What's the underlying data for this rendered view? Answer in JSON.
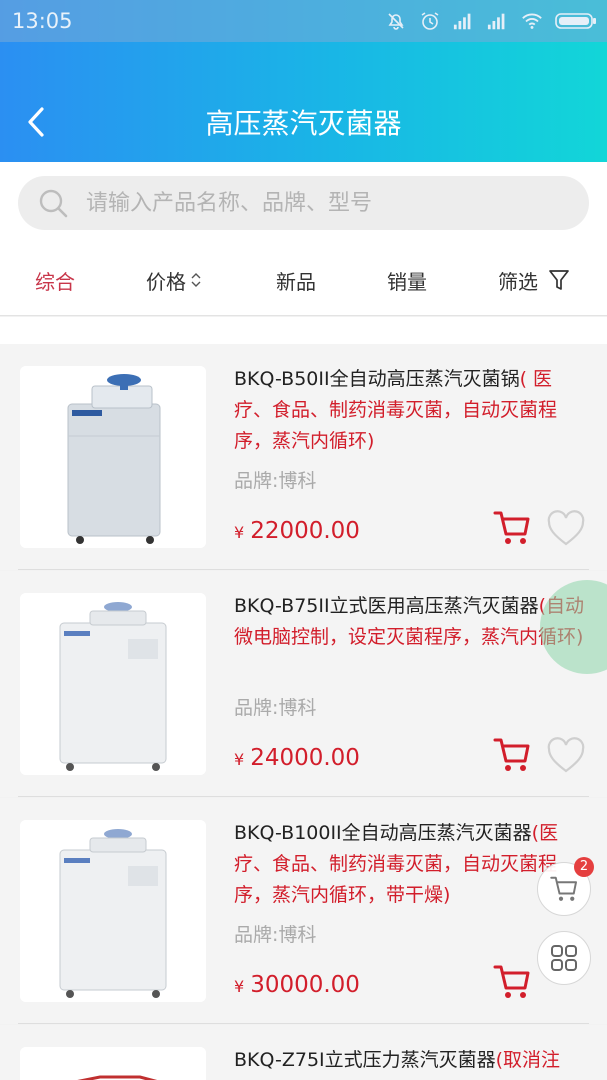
{
  "status": {
    "time": "13:05"
  },
  "header": {
    "title": "高压蒸汽灭菌器"
  },
  "search": {
    "placeholder": "请输入产品名称、品牌、型号"
  },
  "sort": {
    "items": [
      {
        "label": "综合",
        "active": true
      },
      {
        "label": "价格",
        "icon": "sort-updown-icon"
      },
      {
        "label": "新品"
      },
      {
        "label": "销量"
      },
      {
        "label": "筛选",
        "icon": "filter-icon"
      }
    ]
  },
  "products": [
    {
      "name": "BKQ-B50II全自动高压蒸汽灭菌锅",
      "desc": "( 医疗、食品、制药消毒灭菌，自动灭菌程序，蒸汽内循环)",
      "brand": "品牌:博科",
      "currency": "¥",
      "price": "22000.00"
    },
    {
      "name": "BKQ-B75II立式医用高压蒸汽灭菌器",
      "desc": "(自动微电脑控制，设定灭菌程序，蒸汽内循环)",
      "brand": "品牌:博科",
      "currency": "¥",
      "price": "24000.00"
    },
    {
      "name": "BKQ-B100II全自动高压蒸汽灭菌器",
      "desc": "(医疗、食品、制药消毒灭菌，自动灭菌程序，蒸汽内循环，带干燥)",
      "brand": "品牌:博科",
      "currency": "¥",
      "price": "30000.00"
    },
    {
      "name": "BKQ-Z75I立式压力蒸汽灭菌器",
      "desc": "(取消注",
      "brand": "",
      "currency": "",
      "price": ""
    }
  ],
  "floating": {
    "cart_count": "2"
  },
  "colors": {
    "accent": "#c8364a",
    "price": "#d21e2b",
    "header_start": "#2b8ff2",
    "header_end": "#12d6d8"
  }
}
